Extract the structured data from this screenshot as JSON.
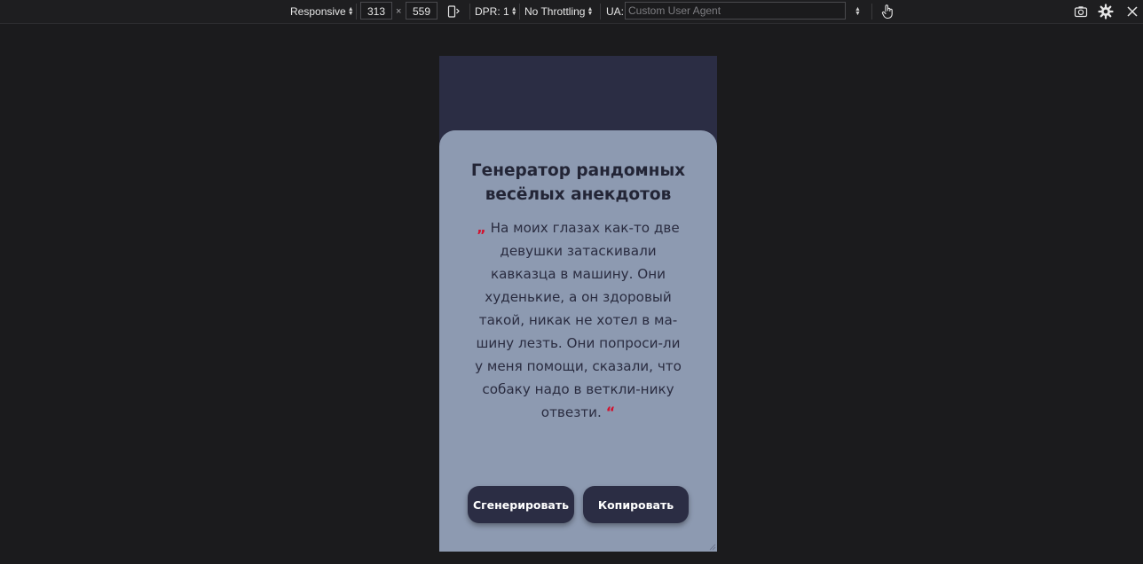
{
  "toolbar": {
    "device_mode": "Responsive",
    "width": "313",
    "times": "×",
    "height": "559",
    "dpr_label": "DPR: 1",
    "throttling": "No Throttling",
    "ua_label": "UA:",
    "ua_placeholder": "Custom User Agent",
    "icons": [
      "rotate-icon",
      "touch-icon",
      "screenshot-icon",
      "settings-icon",
      "close-icon"
    ]
  },
  "app": {
    "title": "Генератор рандомных весёлых анекдотов",
    "open_quote": "„",
    "joke": "На моих глазах как-то две девушки затаскивали кавказца в машину. Они худенькие, а он здоровый такой, никак не хотел в ма-шину лезть. Они попроси-ли у меня помощи, сказали, что собаку надо в веткли-нику отвезти.",
    "close_quote": "“",
    "generate_button": "Сгенерировать",
    "copy_button": "Копировать",
    "colors": {
      "header_bg": "#2b2d44",
      "card_bg": "#8d9ab1",
      "quote_accent": "#d2122e",
      "button_bg": "#2b2d44"
    }
  }
}
